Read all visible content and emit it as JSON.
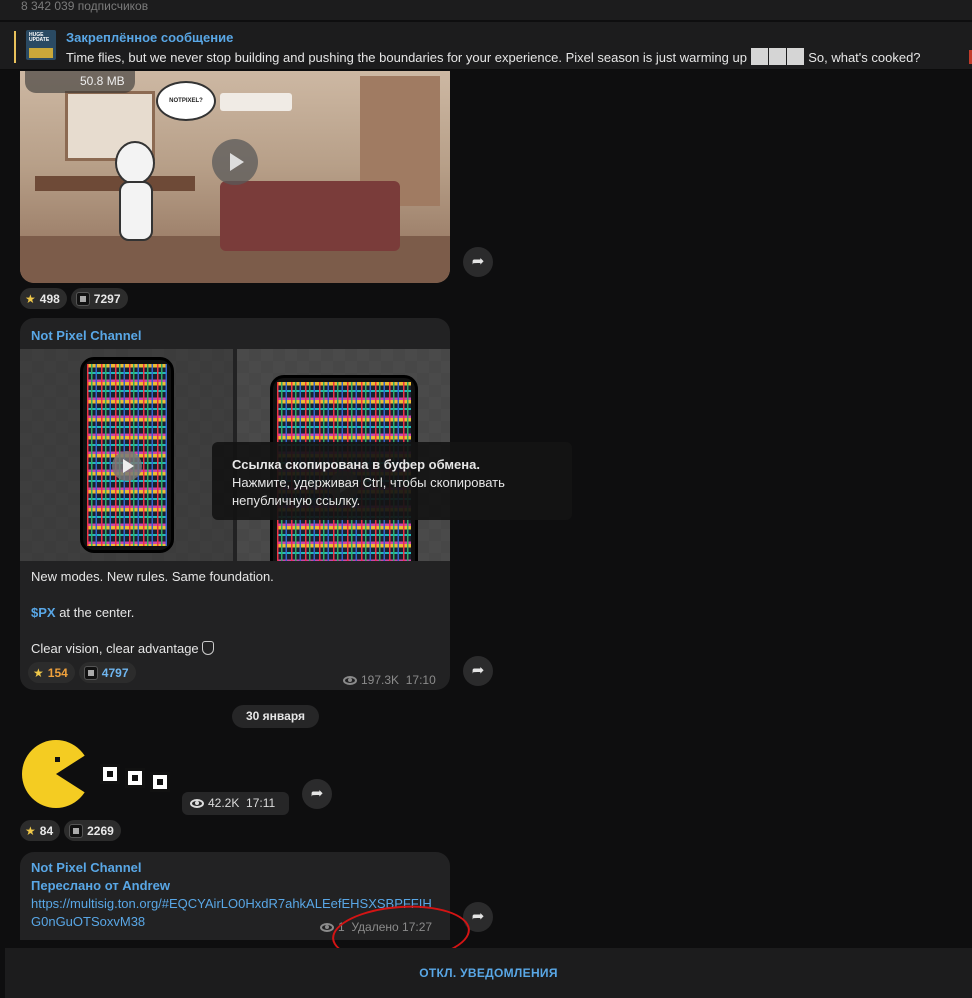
{
  "header": {
    "subscribers": "8 342 039 подписчиков"
  },
  "pinned": {
    "title": "Закреплённое сообщение",
    "text_before": "Time flies, but we never stop building and pushing the boundaries for your experience.   Pixel season is just warming up",
    "text_after": "So, what's cooked?",
    "thumb_label": "HUGE UPDATE"
  },
  "video_message": {
    "file_size": "50.8 MB",
    "bubble_text": "NOTPIXEL?",
    "reactions": [
      {
        "icon": "star-icon",
        "count": "498"
      },
      {
        "icon": "notpixel-icon",
        "count": "7297"
      }
    ]
  },
  "message2": {
    "channel": "Not Pixel Channel",
    "line1": "New modes. New rules. Same foundation.",
    "cashtag": "$PX",
    "line2_rest": " at the center.",
    "line3": "Clear vision, clear advantage",
    "reactions": [
      {
        "icon": "star-icon",
        "count": "154"
      },
      {
        "icon": "notpixel-icon",
        "count": "4797"
      }
    ],
    "views": "197.3K",
    "time": "17:10"
  },
  "toast": {
    "title": "Ссылка скопирована в буфер обмена.",
    "text": "Нажмите, удерживая Ctrl, чтобы скопировать непубличную ссылку."
  },
  "date_chip": "30 января",
  "sticker_message": {
    "views": "42.2K",
    "time": "17:11",
    "reactions": [
      {
        "icon": "star-icon",
        "count": "84"
      },
      {
        "icon": "notpixel-icon",
        "count": "2269"
      }
    ]
  },
  "message3": {
    "channel": "Not Pixel Channel",
    "forwarded": "Переслано от Andrew",
    "link": "https://multisig.ton.org/#EQCYAirLO0HxdR7ahkALEefEHSXSBPFFIHG0nGuOTSoxvM38",
    "views": "1",
    "status": "Удалено 17:27"
  },
  "bottom": {
    "mute_label": "ОТКЛ. УВЕДОМЛЕНИЯ"
  },
  "colors": {
    "accent": "#59a7e6",
    "background": "#0e0e0f",
    "bubble": "#222223",
    "annotation": "#d41414"
  }
}
